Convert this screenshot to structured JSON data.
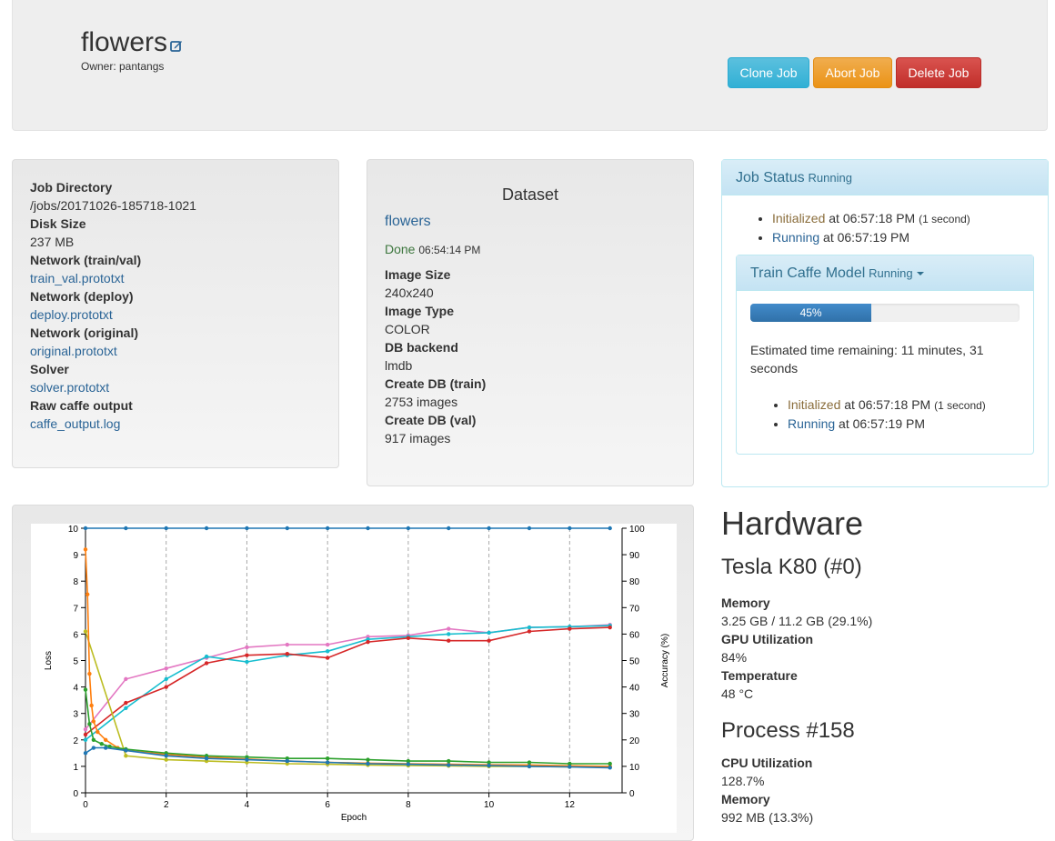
{
  "header": {
    "job_name": "flowers",
    "owner": "Owner: pantangs",
    "clone_label": "Clone Job",
    "abort_label": "Abort Job",
    "delete_label": "Delete Job"
  },
  "job_info": [
    {
      "label": "Job Directory",
      "value": "/jobs/20171026-185718-1021",
      "link": false
    },
    {
      "label": "Disk Size",
      "value": "237 MB",
      "link": false
    },
    {
      "label": "Network (train/val)",
      "value": "train_val.prototxt",
      "link": true
    },
    {
      "label": "Network (deploy)",
      "value": "deploy.prototxt",
      "link": true
    },
    {
      "label": "Network (original)",
      "value": "original.prototxt",
      "link": true
    },
    {
      "label": "Solver",
      "value": "solver.prototxt",
      "link": true
    },
    {
      "label": "Raw caffe output",
      "value": "caffe_output.log",
      "link": true
    }
  ],
  "dataset": {
    "heading": "Dataset",
    "name": "flowers",
    "done_label": "Done",
    "done_time": "06:54:14 PM",
    "fields": [
      {
        "label": "Image Size",
        "value": "240x240"
      },
      {
        "label": "Image Type",
        "value": "COLOR"
      },
      {
        "label": "DB backend",
        "value": "lmdb"
      },
      {
        "label": "Create DB (train)",
        "value": "2753 images"
      },
      {
        "label": "Create DB (val)",
        "value": "917 images"
      }
    ]
  },
  "job_status": {
    "title": "Job Status",
    "state": "Running",
    "events": [
      {
        "name": "Initialized",
        "time": "at 06:57:18 PM",
        "extra": "(1 second)"
      },
      {
        "name": "Running",
        "time": "at 06:57:19 PM",
        "extra": ""
      }
    ],
    "task": {
      "title": "Train Caffe Model",
      "state": "Running",
      "progress": 45,
      "progress_label": "45%",
      "eta": "Estimated time remaining: 11 minutes, 31 seconds",
      "events": [
        {
          "name": "Initialized",
          "time": "at 06:57:18 PM",
          "extra": "(1 second)"
        },
        {
          "name": "Running",
          "time": "at 06:57:19 PM",
          "extra": ""
        }
      ]
    }
  },
  "hardware": {
    "title": "Hardware",
    "gpu_title": "Tesla K80 (#0)",
    "gpu_stats": [
      {
        "label": "Memory",
        "value": "3.25 GB / 11.2 GB (29.1%)"
      },
      {
        "label": "GPU Utilization",
        "value": "84%"
      },
      {
        "label": "Temperature",
        "value": "48 °C"
      }
    ],
    "process_title": "Process #158",
    "process_stats": [
      {
        "label": "CPU Utilization",
        "value": "128.7%"
      },
      {
        "label": "Memory",
        "value": "992 MB (13.3%)"
      }
    ]
  },
  "colors": {
    "link": "#2a6496",
    "series_blue": "#1f77b4",
    "series_orange": "#ff7f0e",
    "series_green": "#2ca02c",
    "series_red": "#d62728",
    "series_olive": "#bcbd22",
    "series_cyan": "#17becf",
    "series_pink": "#e377c2"
  },
  "chart_data": {
    "type": "line",
    "xlabel": "Epoch",
    "ylabel": "Loss",
    "y2label": "Accuracy (%)",
    "xlim": [
      0,
      13.3
    ],
    "ylim": [
      0,
      10
    ],
    "y2lim": [
      0,
      100
    ],
    "xticks": [
      0,
      2,
      4,
      6,
      8,
      10,
      12
    ],
    "yticks": [
      0,
      1,
      2,
      3,
      4,
      5,
      6,
      7,
      8,
      9,
      10
    ],
    "y2ticks": [
      0,
      10,
      20,
      30,
      40,
      50,
      60,
      70,
      80,
      90,
      100
    ],
    "vertical_grid": true,
    "series": [
      {
        "axis": "y2",
        "color": "#1f77b4",
        "x": [
          0,
          1,
          2,
          3,
          4,
          5,
          6,
          7,
          8,
          9,
          10,
          11,
          12,
          13
        ],
        "y": [
          100,
          100,
          100,
          100,
          100,
          100,
          100,
          100,
          100,
          100,
          100,
          100,
          100,
          100
        ]
      },
      {
        "axis": "y2",
        "color": "#e377c2",
        "x": [
          0,
          1,
          2,
          3,
          4,
          5,
          6,
          7,
          8,
          9,
          10,
          11,
          12,
          13
        ],
        "y": [
          24,
          43,
          47,
          51,
          55,
          56,
          56,
          59,
          59.5,
          62,
          60.5,
          62.5,
          62.8,
          63.5
        ]
      },
      {
        "axis": "y2",
        "color": "#17becf",
        "x": [
          0,
          1,
          2,
          3,
          4,
          5,
          6,
          7,
          8,
          9,
          10,
          11,
          12,
          13
        ],
        "y": [
          20,
          32,
          43,
          51.5,
          49.5,
          52,
          53.5,
          58,
          59,
          60,
          60.5,
          62.5,
          62.8,
          63.2
        ]
      },
      {
        "axis": "y2",
        "color": "#d62728",
        "x": [
          0,
          1,
          2,
          3,
          4,
          5,
          6,
          7,
          8,
          9,
          10,
          11,
          12,
          13
        ],
        "y": [
          22,
          34,
          40,
          49,
          52,
          52.5,
          51,
          57,
          58.5,
          57.5,
          57.5,
          61,
          62,
          62.5
        ]
      },
      {
        "axis": "y",
        "color": "#bcbd22",
        "x": [
          0,
          1,
          2,
          3,
          4,
          5,
          6,
          7,
          8,
          9,
          10,
          11,
          12,
          13
        ],
        "y": [
          6.1,
          1.4,
          1.25,
          1.2,
          1.15,
          1.1,
          1.08,
          1.05,
          1.03,
          1.02,
          1.0,
          1.0,
          0.98,
          0.97
        ]
      },
      {
        "axis": "y",
        "color": "#ff7f0e",
        "x": [
          0,
          0.05,
          0.1,
          0.15,
          0.2,
          0.3,
          0.5,
          0.8,
          1,
          2,
          3,
          4,
          5,
          6,
          7,
          8,
          9,
          10,
          11,
          12,
          13
        ],
        "y": [
          9.2,
          7.5,
          4.5,
          3.3,
          2.7,
          2.3,
          2.0,
          1.7,
          1.6,
          1.45,
          1.35,
          1.28,
          1.2,
          1.15,
          1.12,
          1.1,
          1.08,
          1.06,
          1.05,
          1.02,
          1.0
        ]
      },
      {
        "axis": "y",
        "color": "#2ca02c",
        "x": [
          0,
          0.1,
          0.2,
          0.4,
          0.6,
          1,
          2,
          3,
          4,
          5,
          6,
          7,
          8,
          9,
          10,
          11,
          12,
          13
        ],
        "y": [
          3.9,
          2.6,
          2.0,
          1.85,
          1.75,
          1.65,
          1.5,
          1.4,
          1.35,
          1.3,
          1.3,
          1.25,
          1.2,
          1.2,
          1.15,
          1.15,
          1.1,
          1.1
        ]
      },
      {
        "axis": "y",
        "color": "#1f77b4",
        "x": [
          0,
          0.2,
          0.5,
          1,
          2,
          3,
          4,
          5,
          6,
          7,
          8,
          9,
          10,
          11,
          12,
          13
        ],
        "y": [
          1.5,
          1.7,
          1.7,
          1.6,
          1.4,
          1.3,
          1.25,
          1.2,
          1.15,
          1.1,
          1.08,
          1.05,
          1.03,
          1.0,
          0.98,
          0.95
        ]
      }
    ]
  }
}
